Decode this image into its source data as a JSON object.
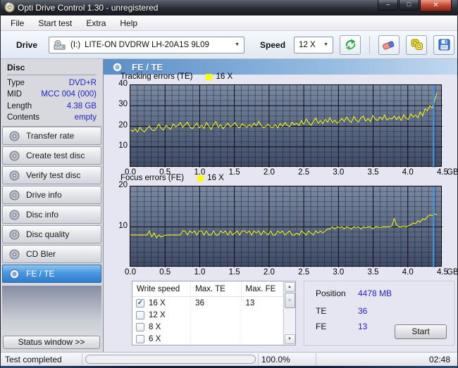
{
  "window": {
    "title": "Opti Drive Control 1.30 - unregistered",
    "controls": {
      "minimize": "–",
      "maximize": "□",
      "close": "✕"
    }
  },
  "menu": {
    "items": [
      "File",
      "Start test",
      "Extra",
      "Help"
    ]
  },
  "toolbar": {
    "drive_label": "Drive",
    "drive_letter": "(I:)",
    "drive_name": "LITE-ON DVDRW LH-20A1S 9L09",
    "speed_label": "Speed",
    "speed_value": "12 X",
    "dropdown_arrow": "▼",
    "icon_buttons": [
      "refresh-icon",
      "eraser-icon",
      "snapshot-icon",
      "save-icon"
    ]
  },
  "disc_panel": {
    "title": "Disc",
    "rows": [
      {
        "label": "Type",
        "value": "DVD+R"
      },
      {
        "label": "MID",
        "value": "MCC 004 (000)"
      },
      {
        "label": "Length",
        "value": "4.38 GB"
      },
      {
        "label": "Contents",
        "value": "empty"
      }
    ]
  },
  "sidebar": {
    "buttons": [
      "Transfer rate",
      "Create test disc",
      "Verify test disc",
      "Drive info",
      "Disc info",
      "Disc quality",
      "CD Bler",
      "FE / TE"
    ],
    "selected": "FE / TE",
    "status_window_button": "Status window >>"
  },
  "main_header": {
    "title": "FE / TE"
  },
  "speed_table": {
    "columns": [
      "Write speed",
      "Max. TE",
      "Max. FE"
    ],
    "check_glyph": "✓",
    "scroll_up": "▲",
    "scroll_down": "▼",
    "thumb_grip": "≡",
    "rows": [
      {
        "speed": "16 X",
        "checked": true,
        "max_te": "36",
        "max_fe": "13"
      },
      {
        "speed": "12 X",
        "checked": false,
        "max_te": "",
        "max_fe": ""
      },
      {
        "speed": "8 X",
        "checked": false,
        "max_te": "",
        "max_fe": ""
      },
      {
        "speed": "6 X",
        "checked": false,
        "max_te": "",
        "max_fe": ""
      }
    ]
  },
  "results_panel": {
    "rows": [
      {
        "label": "Position",
        "value": "4478 MB"
      },
      {
        "label": "TE",
        "value": "36"
      },
      {
        "label": "FE",
        "value": "13"
      }
    ],
    "start_button": "Start"
  },
  "status_bar": {
    "text": "Test completed",
    "percent": "100.0%",
    "progress": 100,
    "time": "02:48"
  },
  "colors": {
    "series_yellow": "#ffff00",
    "position_marker_blue": "#3f97e0",
    "value_text_blue": "#2222cc",
    "chart_bg_top": "#7b89a2",
    "chart_bg_bottom": "#414d68",
    "progress_green": "#28c828"
  },
  "chart_data": [
    {
      "type": "line",
      "title": "Tracking errors (TE)",
      "legend": "16 X",
      "series_color": "#ffff00",
      "ylim": [
        0,
        40
      ],
      "yticks": [
        10,
        20,
        30,
        40
      ],
      "minor_y_step": 2.5,
      "xlim": [
        0,
        4.5
      ],
      "xticks": [
        0,
        0.5,
        1,
        1.5,
        2,
        2.5,
        3,
        3.5,
        4,
        4.5
      ],
      "xtick_labels": [
        "0.0",
        "0.5",
        "1.0",
        "1.5",
        "2.0",
        "2.5",
        "3.0",
        "3.5",
        "4.0",
        "4.5"
      ],
      "minor_x_step": 0.1,
      "x_unit": "GB",
      "position_marker_gb": 4.37,
      "x_start": 0,
      "x_end": 4.42,
      "values": [
        18.2,
        17.5,
        18.8,
        17.2,
        19.5,
        18.0,
        17.3,
        18.9,
        20.1,
        18.3,
        17.8,
        19.2,
        21.0,
        19.0,
        18.2,
        20.5,
        19.3,
        18.5,
        21.2,
        19.8,
        20.3,
        21.8,
        19.5,
        20.8,
        22.0,
        19.8,
        18.8,
        20.2,
        21.5,
        19.2,
        20.5,
        19.0,
        21.8,
        20.2,
        18.5,
        21.0,
        22.3,
        19.5,
        20.8,
        18.8,
        20.2,
        21.5,
        19.8,
        20.5,
        21.8,
        20.0,
        19.2,
        21.2,
        20.3,
        19.5,
        20.8,
        19.8,
        21.5,
        20.2,
        22.5,
        20.5,
        19.3,
        20.0,
        21.0,
        19.7,
        19.5,
        20.8,
        19.2,
        21.3,
        20.0,
        21.8,
        20.5,
        19.8,
        22.0,
        20.8,
        21.5,
        20.3,
        22.8,
        21.0,
        23.5,
        21.8,
        20.5,
        22.3,
        24.0,
        21.5,
        22.8,
        21.3,
        23.3,
        22.0,
        24.2,
        21.8,
        23.0,
        21.5,
        22.5,
        23.8,
        22.3,
        24.5,
        22.8,
        21.8,
        24.8,
        23.0,
        22.0,
        24.2,
        25.0,
        22.5,
        23.8,
        22.3,
        25.2,
        23.5,
        22.8,
        24.5,
        23.2,
        25.5,
        23.0,
        24.0,
        23.5,
        25.0,
        23.2,
        24.8,
        22.8,
        25.5,
        24.0,
        23.3,
        26.0,
        24.5,
        25.5,
        24.2,
        27.0,
        25.0,
        28.5,
        27.5,
        30.0,
        29.0,
        32.5,
        36.0
      ]
    },
    {
      "type": "line",
      "title": "Focus errors (FE)",
      "legend": "16 X",
      "series_color": "#ffff00",
      "ylim": [
        0,
        20
      ],
      "yticks": [
        10,
        20
      ],
      "minor_y_step": 1.25,
      "xlim": [
        0,
        4.5
      ],
      "xticks": [
        0,
        0.5,
        1,
        1.5,
        2,
        2.5,
        3,
        3.5,
        4,
        4.5
      ],
      "xtick_labels": [
        "0.0",
        "0.5",
        "1.0",
        "1.5",
        "2.0",
        "2.5",
        "3.0",
        "3.5",
        "4.0",
        "4.5"
      ],
      "minor_x_step": 0.1,
      "x_unit": "GB",
      "position_marker_gb": 4.37,
      "x_start": 0,
      "x_end": 4.42,
      "values": [
        8,
        8,
        8,
        8,
        8,
        8,
        8,
        8,
        9,
        7.5,
        8.5,
        7.3,
        8,
        7.5,
        7.8,
        8,
        8,
        8,
        8,
        8,
        8,
        8,
        9,
        9,
        8,
        9,
        8.5,
        9,
        8,
        9,
        9,
        8,
        9,
        8,
        8,
        9,
        8,
        8,
        9,
        8.5,
        9,
        8,
        9,
        8,
        8.5,
        9,
        8,
        9,
        9,
        8.5,
        9,
        8,
        9,
        8.5,
        9,
        8,
        9,
        8.5,
        8,
        9,
        8,
        8,
        9,
        8.5,
        9,
        8,
        8.5,
        9,
        8,
        8,
        8.5,
        8,
        9,
        8.5,
        8,
        9,
        8.5,
        8,
        9,
        8.5,
        9,
        8.5,
        9,
        9.5,
        9.5,
        10,
        9.5,
        10,
        9.8,
        10,
        9.5,
        10,
        9.8,
        9.5,
        10,
        9.8,
        10,
        9.5,
        10,
        9.8,
        10,
        10,
        9.5,
        10,
        10,
        9.8,
        10,
        10,
        10,
        10,
        10.2,
        12,
        10.5,
        10,
        10,
        10.2,
        10,
        10.3,
        10.5,
        11,
        10.8,
        11.5,
        11.2,
        12,
        11.8,
        12.5,
        13,
        12.8,
        13.2,
        13
      ]
    }
  ]
}
